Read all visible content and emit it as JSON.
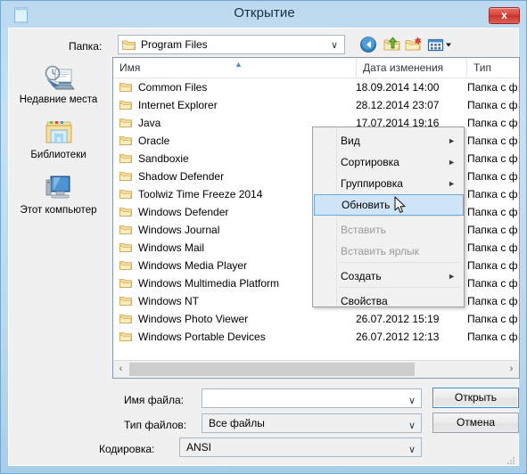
{
  "window": {
    "title": "Открытие",
    "icon": "notepad-document-icon",
    "close_label": "x",
    "frame_color": "#b9d7ec",
    "titlebar_text_color": "#1b2f43",
    "close_button_color": "#d9453e"
  },
  "toolbar": {
    "look_in_label": "Папка:",
    "current_folder": "Program Files",
    "buttons": [
      {
        "name": "back-button",
        "icon": "back-arrow-icon"
      },
      {
        "name": "up-level-button",
        "icon": "up-folder-icon"
      },
      {
        "name": "new-folder-button",
        "icon": "new-folder-icon"
      },
      {
        "name": "views-button",
        "icon": "views-grid-icon"
      }
    ]
  },
  "places": [
    {
      "label": "Недавние места",
      "icon": "recent-places-icon"
    },
    {
      "label": "Библиотеки",
      "icon": "libraries-folder-icon"
    },
    {
      "label": "Этот компьютер",
      "icon": "this-pc-icon"
    }
  ],
  "file_list": {
    "columns": [
      "Имя",
      "Дата изменения",
      "Тип"
    ],
    "sort_column": "Имя",
    "sort_direction": "ascending",
    "rows": [
      {
        "name": "Common Files",
        "date": "18.09.2014 14:00",
        "type": "Папка с ф"
      },
      {
        "name": "Internet Explorer",
        "date": "28.12.2014 23:07",
        "type": "Папка с ф"
      },
      {
        "name": "Java",
        "date": "17.07.2014 19:16",
        "type": "Папка с ф"
      },
      {
        "name": "Oracle",
        "date": "",
        "type": "Папка с ф"
      },
      {
        "name": "Sandboxie",
        "date": "",
        "type": "Папка с ф"
      },
      {
        "name": "Shadow Defender",
        "date": "",
        "type": "Папка с ф"
      },
      {
        "name": "Toolwiz Time Freeze 2014",
        "date": "",
        "type": "Папка с ф"
      },
      {
        "name": "Windows Defender",
        "date": "",
        "type": "Папка с ф"
      },
      {
        "name": "Windows Journal",
        "date": "",
        "type": "Папка с ф"
      },
      {
        "name": "Windows Mail",
        "date": "",
        "type": "Папка с ф"
      },
      {
        "name": "Windows Media Player",
        "date": "",
        "type": "Папка с ф"
      },
      {
        "name": "Windows Multimedia Platform",
        "date": "",
        "type": "Папка с ф"
      },
      {
        "name": "Windows NT",
        "date": "",
        "type": "Папка с ф"
      },
      {
        "name": "Windows Photo Viewer",
        "date": "26.07.2012 15:19",
        "type": "Папка с ф"
      },
      {
        "name": "Windows Portable Devices",
        "date": "26.07.2012 12:13",
        "type": "Папка с ф"
      }
    ]
  },
  "hscroll": {
    "left_arrow": "‹",
    "right_arrow": "›"
  },
  "context_menu": {
    "highlighted": "Обновить",
    "items": [
      {
        "label": "Вид",
        "submenu": true,
        "disabled": false
      },
      {
        "label": "Сортировка",
        "submenu": true,
        "disabled": false
      },
      {
        "label": "Группировка",
        "submenu": true,
        "disabled": false
      },
      {
        "label": "Обновить",
        "submenu": false,
        "disabled": false
      },
      {
        "label": "Вставить",
        "submenu": false,
        "disabled": true
      },
      {
        "label": "Вставить ярлык",
        "submenu": false,
        "disabled": true
      },
      {
        "label": "Создать",
        "submenu": true,
        "disabled": false
      },
      {
        "label": "Свойства",
        "submenu": false,
        "disabled": false
      }
    ],
    "submenu_arrow": "►",
    "highlight_color": "#cfe4f7"
  },
  "form": {
    "file_name_label": "Имя файла:",
    "file_name_value": "",
    "file_type_label": "Тип файлов:",
    "file_type_value": "Все файлы",
    "encoding_label": "Кодировка:",
    "encoding_value": "ANSI",
    "open_button": "Открыть",
    "cancel_button": "Отмена",
    "chevron": "∨"
  }
}
